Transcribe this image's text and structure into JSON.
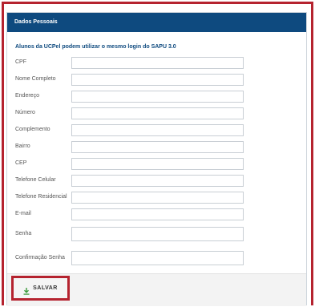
{
  "panel": {
    "title": "Dados Pessoais",
    "notice": "Alunos da UCPel podem utilizar o mesmo login do SAPU 3.0"
  },
  "fields": [
    {
      "label": "CPF",
      "value": ""
    },
    {
      "label": "Nome Completo",
      "value": ""
    },
    {
      "label": "Endereço",
      "value": ""
    },
    {
      "label": "Número",
      "value": ""
    },
    {
      "label": "Complemento",
      "value": ""
    },
    {
      "label": "Bairro",
      "value": ""
    },
    {
      "label": "CEP",
      "value": ""
    },
    {
      "label": "Telefone Celular",
      "value": ""
    },
    {
      "label": "Telefone Residencial",
      "value": ""
    },
    {
      "label": "E-mail",
      "value": ""
    },
    {
      "label": "Senha",
      "value": ""
    },
    {
      "label": "Confirmação Senha",
      "value": ""
    }
  ],
  "actions": {
    "save_label": "SALVAR",
    "save_icon": "download-icon"
  },
  "colors": {
    "header_bg": "#0e4a7f",
    "highlight": "#b5232f",
    "save_icon": "#3a9a3a"
  }
}
